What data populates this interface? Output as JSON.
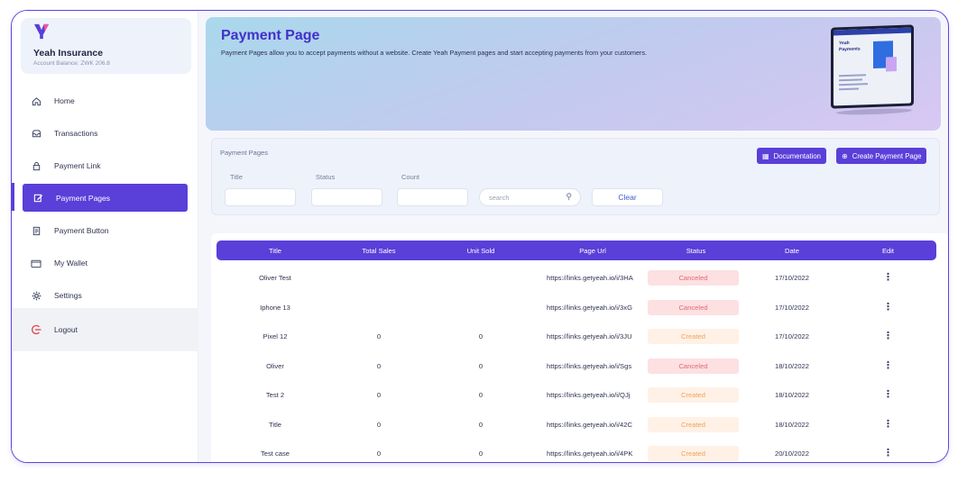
{
  "sidebar": {
    "company": "Yeah Insurance",
    "balance": "Account Balance: ZWK 206.8",
    "items": [
      {
        "label": "Home",
        "icon": "home-icon"
      },
      {
        "label": "Transactions",
        "icon": "inbox-icon"
      },
      {
        "label": "Payment Link",
        "icon": "lock-icon"
      },
      {
        "label": "Payment Pages",
        "icon": "edit-icon",
        "active": true
      },
      {
        "label": "Payment Button",
        "icon": "receipt-icon"
      },
      {
        "label": "My Wallet",
        "icon": "wallet-icon"
      },
      {
        "label": "Settings",
        "icon": "gear-icon"
      }
    ],
    "logout": "Logout"
  },
  "hero": {
    "title": "Payment Page",
    "subtitle": "Payment Pages allow you to accept payments without a website. Create Yeah Payment pages and start accepting payments from your customers.",
    "tablet_text": "Yeah Payments"
  },
  "filters": {
    "title": "Payment Pages",
    "documentation": "Documentation",
    "create": "Create Payment Page",
    "title_label": "Title",
    "status_label": "Status",
    "count_label": "Count",
    "search_placeholder": "search",
    "clear": "Clear"
  },
  "table": {
    "headers": [
      "Title",
      "Total Sales",
      "Unit Sold",
      "Page Url",
      "Status",
      "Date",
      "Edit"
    ],
    "rows": [
      {
        "title": "Oliver Test",
        "sales": "",
        "units": "",
        "url": "https://links.getyeah.io/i/3HA",
        "status": "Canceled",
        "date": "17/10/2022"
      },
      {
        "title": "Iphone 13",
        "sales": "",
        "units": "",
        "url": "https://links.getyeah.io/i/3xG",
        "status": "Canceled",
        "date": "17/10/2022"
      },
      {
        "title": "Pixel 12",
        "sales": "0",
        "units": "0",
        "url": "https://links.getyeah.io/i/3JU",
        "status": "Created",
        "date": "17/10/2022"
      },
      {
        "title": "Oliver",
        "sales": "0",
        "units": "0",
        "url": "https://links.getyeah.io/i/Sgs",
        "status": "Canceled",
        "date": "18/10/2022"
      },
      {
        "title": "Test 2",
        "sales": "0",
        "units": "0",
        "url": "https://links.getyeah.io/i/QJj",
        "status": "Created",
        "date": "18/10/2022"
      },
      {
        "title": "Title",
        "sales": "0",
        "units": "0",
        "url": "https://links.getyeah.io/i/42C",
        "status": "Created",
        "date": "18/10/2022"
      },
      {
        "title": "Test case",
        "sales": "0",
        "units": "0",
        "url": "https://links.getyeah.io/i/4PK",
        "status": "Created",
        "date": "20/10/2022"
      }
    ],
    "edit_glyph": "⋮"
  },
  "colors": {
    "accent": "#5a3fd8",
    "canceled_bg": "#fde0e2",
    "created_bg": "#fff1e6"
  }
}
